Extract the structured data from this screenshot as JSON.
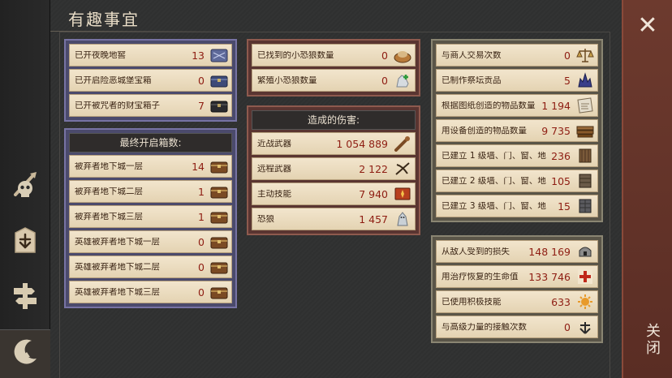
{
  "title": "有趣事宜",
  "close_label": "关闭",
  "close_symbol": "✕",
  "colors": {
    "accent": "#8e1d12",
    "purple_border": "#7773a4",
    "red_border": "#8e5a4e",
    "close_strip": "#6d3a2e"
  },
  "left_col": {
    "top_rows": [
      {
        "label": "已开夜晚地窖",
        "value": "13",
        "icon": "ledger-icon"
      },
      {
        "label": "已开启险恶城堡宝箱",
        "value": "0",
        "icon": "chest-blue-icon"
      },
      {
        "label": "已开被咒者的财宝箱子",
        "value": "7",
        "icon": "chest-dark-icon"
      }
    ],
    "chests_header": "最终开启箱数:",
    "chest_rows": [
      {
        "label": "被弃者地下城一层",
        "value": "14",
        "icon": "chest-icon"
      },
      {
        "label": "被弃者地下城二层",
        "value": "1",
        "icon": "chest-icon"
      },
      {
        "label": "被弃者地下城三层",
        "value": "1",
        "icon": "chest-icon"
      },
      {
        "label": "英雄被弃者地下城一层",
        "value": "0",
        "icon": "chest-icon"
      },
      {
        "label": "英雄被弃者地下城二层",
        "value": "0",
        "icon": "chest-icon"
      },
      {
        "label": "英雄被弃者地下城三层",
        "value": "0",
        "icon": "chest-icon"
      }
    ]
  },
  "mid_col": {
    "top_rows": [
      {
        "label": "已找到的小恐狼数量",
        "value": "0",
        "icon": "basket-icon"
      },
      {
        "label": "繁殖小恐狼数量",
        "value": "0",
        "icon": "wolf-pup-icon"
      }
    ],
    "damage_header": "造成的伤害:",
    "damage_rows": [
      {
        "label": "近战武器",
        "value": "1 054 889",
        "icon": "club-icon"
      },
      {
        "label": "远程武器",
        "value": "2 122",
        "icon": "crossbow-icon"
      },
      {
        "label": "主动技能",
        "value": "7 940",
        "icon": "skill-book-icon"
      },
      {
        "label": "恐狼",
        "value": "1 457",
        "icon": "wolf-icon"
      }
    ]
  },
  "right_col": {
    "top_rows": [
      {
        "label": "与商人交易次数",
        "value": "0",
        "icon": "scales-icon"
      },
      {
        "label": "已制作祭坛贡品",
        "value": "5",
        "icon": "altar-icon"
      },
      {
        "label": "根据图纸创造的物品数量",
        "value": "1 194",
        "icon": "blueprint-icon"
      },
      {
        "label": "用设备创造的物品数量",
        "value": "9 735",
        "icon": "planks-icon"
      },
      {
        "label": "已建立 1 级墙、门、窗、地",
        "value": "236",
        "icon": "wall1-icon"
      },
      {
        "label": "已建立 2 级墙、门、窗、地",
        "value": "105",
        "icon": "wall2-icon"
      },
      {
        "label": "已建立 3 级墙、门、窗、地",
        "value": "15",
        "icon": "wall3-icon"
      }
    ],
    "bottom_rows": [
      {
        "label": "从敌人受到的损失",
        "value": "148 169",
        "icon": "helmet-icon"
      },
      {
        "label": "用治疗恢复的生命值",
        "value": "133 746",
        "icon": "red-cross-icon"
      },
      {
        "label": "已使用积极技能",
        "value": "633",
        "icon": "sun-icon"
      },
      {
        "label": "与高级力量的接触次数",
        "value": "0",
        "icon": "rune-icon"
      }
    ]
  }
}
